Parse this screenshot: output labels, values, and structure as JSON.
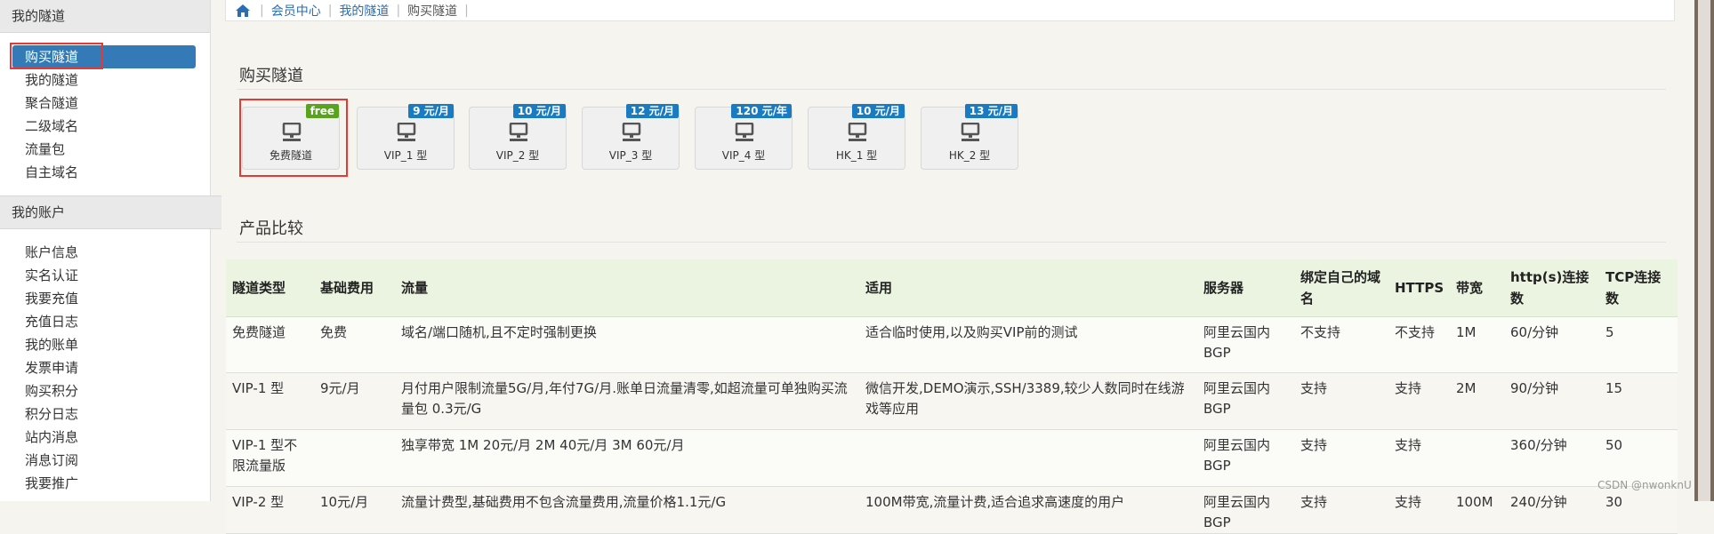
{
  "sidebar": {
    "sections": [
      {
        "title": "我的隧道",
        "items": [
          {
            "label": "购买隧道",
            "active": true
          },
          {
            "label": "我的隧道"
          },
          {
            "label": "聚合隧道"
          },
          {
            "label": "二级域名"
          },
          {
            "label": "流量包"
          },
          {
            "label": "自主域名"
          }
        ]
      },
      {
        "title": "我的账户",
        "items": [
          {
            "label": "账户信息"
          },
          {
            "label": "实名认证"
          },
          {
            "label": "我要充值"
          },
          {
            "label": "充值日志"
          },
          {
            "label": "我的账单"
          },
          {
            "label": "发票申请"
          },
          {
            "label": "购买积分"
          },
          {
            "label": "积分日志"
          },
          {
            "label": "站内消息"
          },
          {
            "label": "消息订阅"
          },
          {
            "label": "我要推广"
          }
        ]
      }
    ]
  },
  "breadcrumb": {
    "home_icon": "home-icon",
    "items": [
      "会员中心",
      "我的隧道",
      "购买隧道"
    ]
  },
  "buy_section": {
    "title": "购买隧道",
    "cards": [
      {
        "label": "免费隧道",
        "badge": "free",
        "icon": "network-icon"
      },
      {
        "label": "VIP_1 型",
        "badge": "9 元/月",
        "icon": "network-icon"
      },
      {
        "label": "VIP_2 型",
        "badge": "10 元/月",
        "icon": "network-icon"
      },
      {
        "label": "VIP_3 型",
        "badge": "12 元/月",
        "icon": "network-icon"
      },
      {
        "label": "VIP_4 型",
        "badge": "120 元/年",
        "icon": "network-icon"
      },
      {
        "label": "HK_1 型",
        "badge": "10 元/月",
        "icon": "network-icon"
      },
      {
        "label": "HK_2 型",
        "badge": "13 元/月",
        "icon": "network-icon"
      }
    ]
  },
  "compare_section": {
    "title": "产品比较",
    "headers": [
      "隧道类型",
      "基础费用",
      "流量",
      "适用",
      "服务器",
      "绑定自己的域名",
      "HTTPS",
      "带宽",
      "http(s)连接数",
      "TCP连接数"
    ],
    "rows": [
      [
        "免费隧道",
        "免费",
        "域名/端口随机,且不定时强制更换",
        "适合临时使用,以及购买VIP前的测试",
        "阿里云国内BGP",
        "不支持",
        "不支持",
        "1M",
        "60/分钟",
        "5"
      ],
      [
        "VIP-1 型",
        "9元/月",
        "月付用户限制流量5G/月,年付7G/月.账单日流量清零,如超流量可单独购买流量包 0.3元/G",
        "微信开发,DEMO演示,SSH/3389,较少人数同时在线游戏等应用",
        "阿里云国内BGP",
        "支持",
        "支持",
        "2M",
        "90/分钟",
        "15"
      ],
      [
        "VIP-1 型不限流量版",
        "",
        "独享带宽 1M 20元/月 2M 40元/月 3M 60元/月",
        "",
        "阿里云国内BGP",
        "支持",
        "支持",
        "",
        "360/分钟",
        "50"
      ],
      [
        "VIP-2 型",
        "10元/月",
        "流量计费型,基础费用不包含流量费用,流量价格1.1元/G",
        "100M带宽,流量计费,适合追求高速度的用户",
        "阿里云国内BGP",
        "支持",
        "支持",
        "100M",
        "240/分钟",
        "30"
      ]
    ]
  },
  "watermark": "CSDN @nwonknU"
}
